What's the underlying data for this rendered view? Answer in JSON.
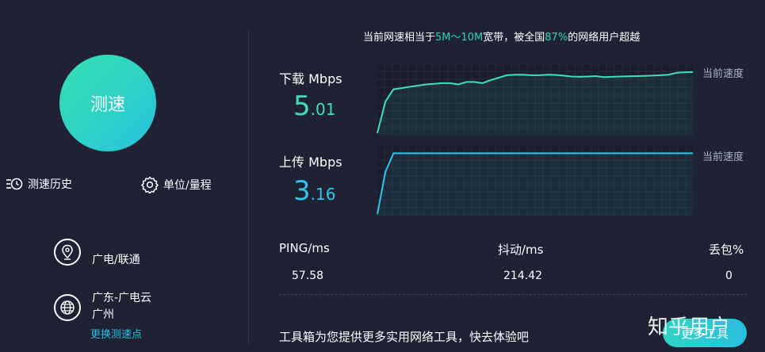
{
  "speed_button": {
    "label": "测速"
  },
  "tools": {
    "history_label": "测速历史",
    "unit_label": "单位/量程"
  },
  "isp": {
    "carrier": "广电/联通",
    "node_line1": "广东-广电云",
    "node_line2": "广州",
    "change_node": "更换测速点"
  },
  "summary": {
    "prefix": "当前网速相当于",
    "range": "5M～10M",
    "mid": "宽带，被全国",
    "percent": "87%",
    "suffix": "的网络用户超越"
  },
  "download": {
    "label": "下载",
    "unit": "Mbps",
    "value_int": "5",
    "value_dec": ".01",
    "current_label": "当前速度",
    "color": "#3fe0b8"
  },
  "upload": {
    "label": "上传",
    "unit": "Mbps",
    "value_int": "3",
    "value_dec": ".16",
    "current_label": "当前速度",
    "color": "#2ec6ea"
  },
  "stats": {
    "ping_label": "PING/ms",
    "ping_value": "57.58",
    "jitter_label": "抖动/ms",
    "jitter_value": "214.42",
    "loss_label": "丢包%",
    "loss_value": "0"
  },
  "promo": {
    "text": "工具箱为您提供更多实用网络工具，快去体验吧",
    "button": "更多工具"
  },
  "watermark": "知乎用户",
  "chart_data": [
    {
      "type": "line",
      "name": "download",
      "x": [
        0,
        1,
        2,
        3,
        4,
        5,
        6,
        7,
        8,
        9,
        10,
        11,
        12,
        13,
        14,
        15,
        16,
        17,
        18,
        19,
        20,
        21,
        22,
        23,
        24,
        25,
        26,
        27,
        28,
        29,
        30,
        31,
        32,
        33,
        34,
        35,
        36,
        37,
        38,
        39
      ],
      "values": [
        0,
        2.6,
        3.6,
        3.7,
        3.8,
        3.9,
        4.0,
        4.05,
        4.1,
        4.1,
        4.0,
        4.2,
        4.2,
        4.1,
        4.35,
        4.55,
        4.75,
        4.8,
        4.8,
        4.75,
        4.75,
        4.8,
        4.78,
        4.72,
        4.65,
        4.62,
        4.65,
        4.68,
        4.6,
        4.62,
        4.65,
        4.66,
        4.68,
        4.7,
        4.72,
        4.75,
        4.8,
        4.95,
        5.0,
        5.01
      ]
    },
    {
      "type": "line",
      "name": "upload",
      "x": [
        0,
        1,
        2,
        3,
        4,
        5,
        6,
        7,
        8,
        9,
        10,
        11,
        12,
        13,
        14,
        15,
        16,
        17,
        18,
        19,
        20,
        21,
        22,
        23,
        24,
        25,
        26,
        27,
        28,
        29,
        30,
        31,
        32,
        33,
        34,
        35,
        36,
        37,
        38,
        39
      ],
      "values": [
        0,
        2.2,
        3.16,
        3.16,
        3.16,
        3.16,
        3.16,
        3.16,
        3.16,
        3.16,
        3.16,
        3.16,
        3.16,
        3.16,
        3.16,
        3.16,
        3.16,
        3.16,
        3.16,
        3.16,
        3.16,
        3.16,
        3.16,
        3.16,
        3.16,
        3.16,
        3.16,
        3.16,
        3.16,
        3.16,
        3.16,
        3.16,
        3.16,
        3.16,
        3.16,
        3.16,
        3.16,
        3.16,
        3.16,
        3.16
      ]
    }
  ]
}
